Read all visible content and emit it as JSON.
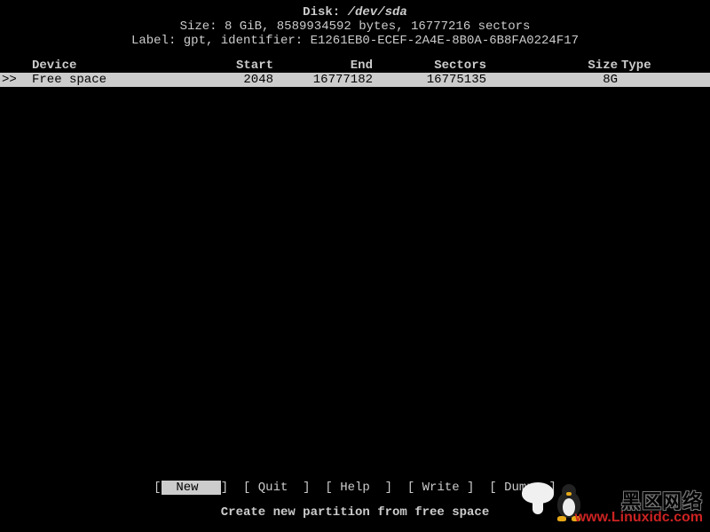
{
  "header": {
    "disk_label": "Disk: ",
    "disk_path": "/dev/sda",
    "size_line": "Size: 8 GiB, 8589934592 bytes, 16777216 sectors",
    "label_line": "Label: gpt, identifier: E1261EB0-ECEF-2A4E-8B0A-6B8FA0224F17"
  },
  "table": {
    "columns": {
      "device": "Device",
      "start": "Start",
      "end": "End",
      "sectors": "Sectors",
      "size": "Size",
      "type": "Type"
    },
    "rows": [
      {
        "marker": ">>",
        "device": "Free space",
        "start": "2048",
        "end": "16777182",
        "sectors": "16775135",
        "size": "8G",
        "type": ""
      }
    ]
  },
  "menu": {
    "items": [
      {
        "label": "  New   ",
        "selected": true
      },
      {
        "label": " Quit  ",
        "selected": false
      },
      {
        "label": " Help  ",
        "selected": false
      },
      {
        "label": " Write ",
        "selected": false
      },
      {
        "label": " Dump  ",
        "selected": false
      }
    ]
  },
  "status": "Create new partition from free space",
  "watermark": {
    "zh": "黑区网络",
    "url": "www.Linuxidc.com"
  }
}
